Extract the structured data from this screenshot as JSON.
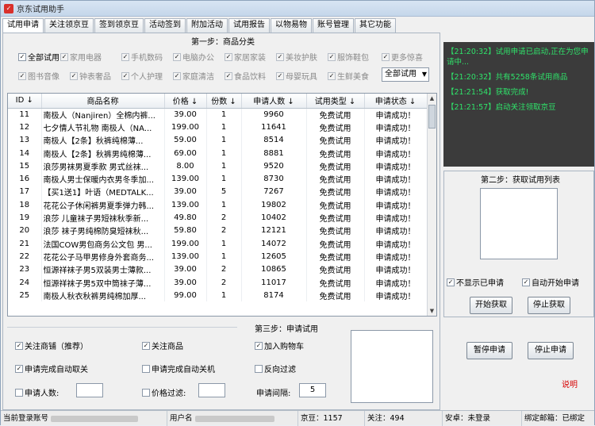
{
  "window": {
    "title": "京东试用助手"
  },
  "tabs": [
    "试用申请",
    "关注领京豆",
    "签到领京豆",
    "活动签到",
    "附加活动",
    "试用报告",
    "以物易物",
    "账号管理",
    "其它功能"
  ],
  "step1": {
    "title": "第一步：商品分类",
    "row1": [
      {
        "label": "全部试用",
        "checked": true,
        "enabled": true
      },
      {
        "label": "家用电器",
        "checked": true,
        "enabled": false
      },
      {
        "label": "手机数码",
        "checked": true,
        "enabled": false
      },
      {
        "label": "电脑办公",
        "checked": true,
        "enabled": false
      },
      {
        "label": "家居家装",
        "checked": true,
        "enabled": false
      },
      {
        "label": "美妆护肤",
        "checked": true,
        "enabled": false
      },
      {
        "label": "服饰鞋包",
        "checked": true,
        "enabled": false
      },
      {
        "label": "更多惊喜",
        "checked": true,
        "enabled": false
      }
    ],
    "row2": [
      {
        "label": "图书音像",
        "checked": true,
        "enabled": false
      },
      {
        "label": "钟表奢品",
        "checked": true,
        "enabled": false
      },
      {
        "label": "个人护理",
        "checked": true,
        "enabled": false
      },
      {
        "label": "家庭清洁",
        "checked": true,
        "enabled": false
      },
      {
        "label": "食品饮料",
        "checked": true,
        "enabled": false
      },
      {
        "label": "母婴玩具",
        "checked": true,
        "enabled": false
      },
      {
        "label": "生鲜美食",
        "checked": true,
        "enabled": false
      }
    ],
    "select_value": "全部试用"
  },
  "table": {
    "columns": [
      "ID ↓",
      "商品名称",
      "价格 ↓",
      "份数 ↓",
      "申请人数 ↓",
      "试用类型 ↓",
      "申请状态 ↓"
    ],
    "rows": [
      [
        "11",
        "南极人（Nanjiren）全棉内裤...",
        "39.00",
        "1",
        "9960",
        "免费试用",
        "申请成功！"
      ],
      [
        "12",
        "七夕情人节礼物 南极人（NA...",
        "199.00",
        "1",
        "11641",
        "免费试用",
        "申请成功！"
      ],
      [
        "13",
        "南极人【2条】秋裤纯棉薄...",
        "59.00",
        "1",
        "8514",
        "免费试用",
        "申请成功！"
      ],
      [
        "14",
        "南极人【2条】秋裤男纯棉薄...",
        "69.00",
        "1",
        "8881",
        "免费试用",
        "申请成功！"
      ],
      [
        "15",
        "浪莎男袜男夏季款 男式丝袜...",
        "8.00",
        "1",
        "9520",
        "免费试用",
        "申请成功！"
      ],
      [
        "16",
        "南极人男士保暖内衣男冬季加...",
        "139.00",
        "1",
        "8730",
        "免费试用",
        "申请成功！"
      ],
      [
        "17",
        "【买1送1】叶语（MEDTALK...",
        "39.00",
        "5",
        "7267",
        "免费试用",
        "申请成功！"
      ],
      [
        "18",
        "花花公子休闲裤男夏季弹力韩...",
        "139.00",
        "1",
        "19802",
        "免费试用",
        "申请成功！"
      ],
      [
        "19",
        "浪莎 儿童袜子男短袜秋季新...",
        "49.80",
        "2",
        "10402",
        "免费试用",
        "申请成功！"
      ],
      [
        "20",
        "浪莎 袜子男纯棉防臭短袜秋...",
        "59.80",
        "2",
        "12121",
        "免费试用",
        "申请成功！"
      ],
      [
        "21",
        "法国COW男包商务公文包 男...",
        "199.00",
        "1",
        "14072",
        "免费试用",
        "申请成功！"
      ],
      [
        "22",
        "花花公子马甲男修身外套商务...",
        "139.00",
        "1",
        "12605",
        "免费试用",
        "申请成功！"
      ],
      [
        "23",
        "恒源祥袜子男5双装男士薄款...",
        "39.00",
        "2",
        "10865",
        "免费试用",
        "申请成功！"
      ],
      [
        "24",
        "恒源祥袜子男5双中筒袜子薄...",
        "39.00",
        "2",
        "11017",
        "免费试用",
        "申请成功！"
      ],
      [
        "25",
        "南极人秋衣秋裤男纯棉加厚...",
        "99.00",
        "1",
        "8174",
        "免费试用",
        "申请成功！"
      ]
    ]
  },
  "log": [
    "【21:20:32】试用申请已启动,正在为您申请中...",
    "【21:20:32】共有5258条试用商品",
    "【21:21:54】获取完成!",
    "【21:21:57】启动关注领取京豆"
  ],
  "step2": {
    "title": "第二步：获取试用列表",
    "hide_applied": {
      "label": "不显示已申请",
      "checked": true
    },
    "auto_apply": {
      "label": "自动开始申请",
      "checked": true
    },
    "start_btn": "开始获取",
    "stop_btn": "停止获取"
  },
  "step3": {
    "title": "第三步：申请试用",
    "opts": [
      {
        "label": "关注商铺（推荐）",
        "checked": true
      },
      {
        "label": "关注商品",
        "checked": true
      },
      {
        "label": "加入购物车",
        "checked": true
      },
      {
        "label": "申请完成自动取关",
        "checked": true
      },
      {
        "label": "申请完成自动关机",
        "checked": false
      },
      {
        "label": "反向过滤",
        "checked": false
      }
    ],
    "applicants": {
      "label": "申请人数:",
      "checked": false,
      "value": ""
    },
    "price_filter": {
      "label": "价格过滤:",
      "checked": false,
      "value": ""
    },
    "interval": {
      "label": "申请间隔:",
      "value": "5"
    },
    "pause_btn": "暂停申请",
    "stop_btn": "停止申请",
    "help_link": "说明"
  },
  "status": {
    "account_label": "当前登录账号",
    "username_label": "用户名",
    "jingdou": "京豆：1157",
    "follow": "关注：494",
    "safe": "安卓：未登录",
    "bind": "绑定邮箱：已绑定"
  },
  "colors": {
    "log_bg": "#3b3b3b",
    "log_text": "#2fe36a",
    "link": "#d60000"
  }
}
